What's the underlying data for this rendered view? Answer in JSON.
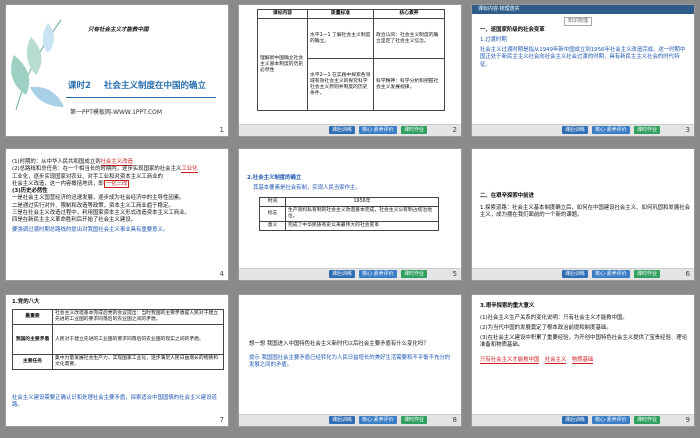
{
  "footer": {
    "prev": "课后训练",
    "mid": "核心·素养评价",
    "next": "课时作业"
  },
  "slides": [
    {
      "num": "1",
      "kicker": "只有社会主义才能救中国",
      "title_prefix": "课时2",
      "title": "社会主义制度在中国的确立",
      "subtitle": "第一PPT模板网-WWW.1PPT.COM"
    },
    {
      "num": "2",
      "headers": [
        "课标内容",
        "质量标准",
        "核心素养"
      ],
      "c1": "理解新中国确立社会主义基本制度的历史必然性",
      "c2a": "水平1—1 了解社会主义制度的确立。",
      "c2b": "水平2—1 在实践中探索各领域有效社会主义的探究科学社会主义原则并制度的历史条件。",
      "c3a": "政治认同：社会主义制度的确立坚定了社会主义信念。",
      "c3b": "科学精神：科学分析和把握社会主义发展规律。"
    },
    {
      "num": "3",
      "header": "课标内容·梳理落实",
      "tag": "知识梳理",
      "h1": "一、逐国家阶级的社会变革",
      "h2": "1.过渡时期",
      "body": "社会主义过渡时期是指从1949年新中国成立到1956年社会主义改造完成。这一时期中国正处于新民主主义社会向社会主义社会过渡的时期，具有新民主主义社会的时代特征。"
    },
    {
      "num": "4",
      "lines": [
        "(1)时期的：从中华人民共和国成立到",
        "(2)总路线和总任务：在一个相当长的时期内，逐步实现国家的社会主义",
        "工业化，逐步实现国家对农业、对手工业和对资本主义工商业的",
        "社会主义改造，这一内容概括地说，即",
        "(3)历史必然性",
        "一是社会主义国营经济的迅速发展，逐步成为社会经济中的主导性因素。",
        "二是通过实行对外、限制和改造等政策，资本主义工商业趋于稳定。",
        "三是在社会主义改造过程中，利用国家资本主义形式改造资本主义工商业。",
        "四是在新民主主义革命胜利后开始了社会主义建设。"
      ],
      "blanks": [
        "社会主义改造",
        "工业化",
        "社会主义改造",
        "一化三改"
      ],
      "note": "要强调过渡时期总路线的提出对我国社会主义事业具有重要意义。"
    },
    {
      "num": "5",
      "section": "2.社会主义制度的确立",
      "intro": "其基本要素是社会有制，实现人民当家作主。",
      "rows": [
        [
          "时间",
          "1956年"
        ],
        [
          "标志",
          "生产资料私有制的社会主义改造基本完成，社会主义公有制占统治地位。"
        ],
        [
          "意义",
          "完成了中华民族有史以来最伟大的社会变革"
        ]
      ],
      "blank": "社会变革"
    },
    {
      "num": "6",
      "h1": "二、在艰辛探索中前进",
      "h2": "1.探索道路：社会主义基本制度确立后，如何在中国建设社会主义、如何巩固和发展社会主义，成为摆在我们面前的一个新的课题。",
      "blank": "社会主义"
    },
    {
      "num": "7",
      "h": "1.党的八大",
      "rows": [
        [
          "我国的主要矛盾",
          "人民对于建立先进的工业国的要求同落后的农业国的现实之间的矛盾。"
        ],
        [
          "主要任务",
          "集中力量发展社会生产力，实现国家工业化，逐步满足人民日益增长的物质和文化需要。"
        ]
      ],
      "top": "社会主义改造基本完成后党的会议提出：当时我国的主要矛盾是人民对于建立先进的工业国的要求同落后的农业国之间的矛盾。",
      "note": "社会主义建设需要正确认识和处理社会主要矛盾，探索适合中国国情的社会主义建设道路。"
    },
    {
      "num": "8",
      "q": "想一想 我国进入中国特色社会主义新时代以后社会主要矛盾有什么变化吗？",
      "a": "提示 我国国社会主要矛盾已经转化为人民日益增长的美好生活需要和不平衡不充分的发展之间的矛盾。"
    },
    {
      "num": "9",
      "h": "3.艰辛探索的重大意义",
      "items": [
        "(1)社会主义生产关系的变化说明：只有社会主义才能救中国。",
        "(2)为当代中国的发展奠定了根本政治前提和制度基础。",
        "(3)在社会主义建设中积累了重要经验，为开创中国特色社会主义提供了宝贵经验、理论准备和物质基础。"
      ],
      "blanks": [
        "只有社会主义才能救中国",
        "社会主义",
        "物质基础"
      ]
    }
  ]
}
